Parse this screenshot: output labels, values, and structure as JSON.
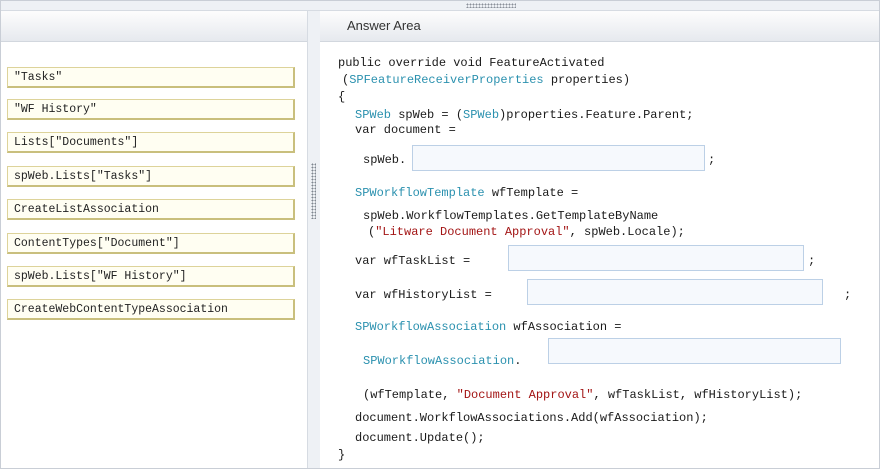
{
  "answer_area": {
    "title": "Answer Area"
  },
  "options": [
    "\"Tasks\"",
    "\"WF History\"",
    "Lists[\"Documents\"]",
    "spWeb.Lists[\"Tasks\"]",
    "CreateListAssociation",
    "ContentTypes[\"Document\"]",
    "spWeb.Lists[\"WF History\"]",
    "CreateWebContentTypeAssociation"
  ],
  "code": {
    "l1": "public override void FeatureActivated",
    "l2_open": "(",
    "l2_type": "SPFeatureReceiverProperties",
    "l2_rest": " properties)",
    "l3": "{",
    "l4_type1": "SPWeb",
    "l4_mid": " spWeb = (",
    "l4_type2": "SPWeb",
    "l4_rest": ")properties.Feature.Parent;",
    "l5": "var document =",
    "l6": "spWeb.",
    "l6_end": ";",
    "l7_type": "SPWorkflowTemplate",
    "l7_rest": " wfTemplate =",
    "l8": "spWeb.WorkflowTemplates.GetTemplateByName",
    "l9_open": "(",
    "l9_str": "\"Litware Document Approval\"",
    "l9_rest": ", spWeb.Locale);",
    "l10": "var wfTaskList =",
    "l10_end": ";",
    "l11": "var wfHistoryList =",
    "l11_end": ";",
    "l12_type": "SPWorkflowAssociation",
    "l12_rest": " wfAssociation =",
    "l13_type": "SPWorkflowAssociation",
    "l13_dot": ".",
    "l14_open": "(wfTemplate, ",
    "l14_str": "\"Document Approval\"",
    "l14_rest": ", wfTaskList, wfHistoryList);",
    "l15": "document.WorkflowAssociations.Add(wfAssociation);",
    "l16": "document.Update();",
    "l17": "}"
  },
  "colors": {
    "type": "#2b91af",
    "string": "#a31515",
    "option_bg": "#fffef2",
    "drop_bg": "#f6f9fd"
  }
}
